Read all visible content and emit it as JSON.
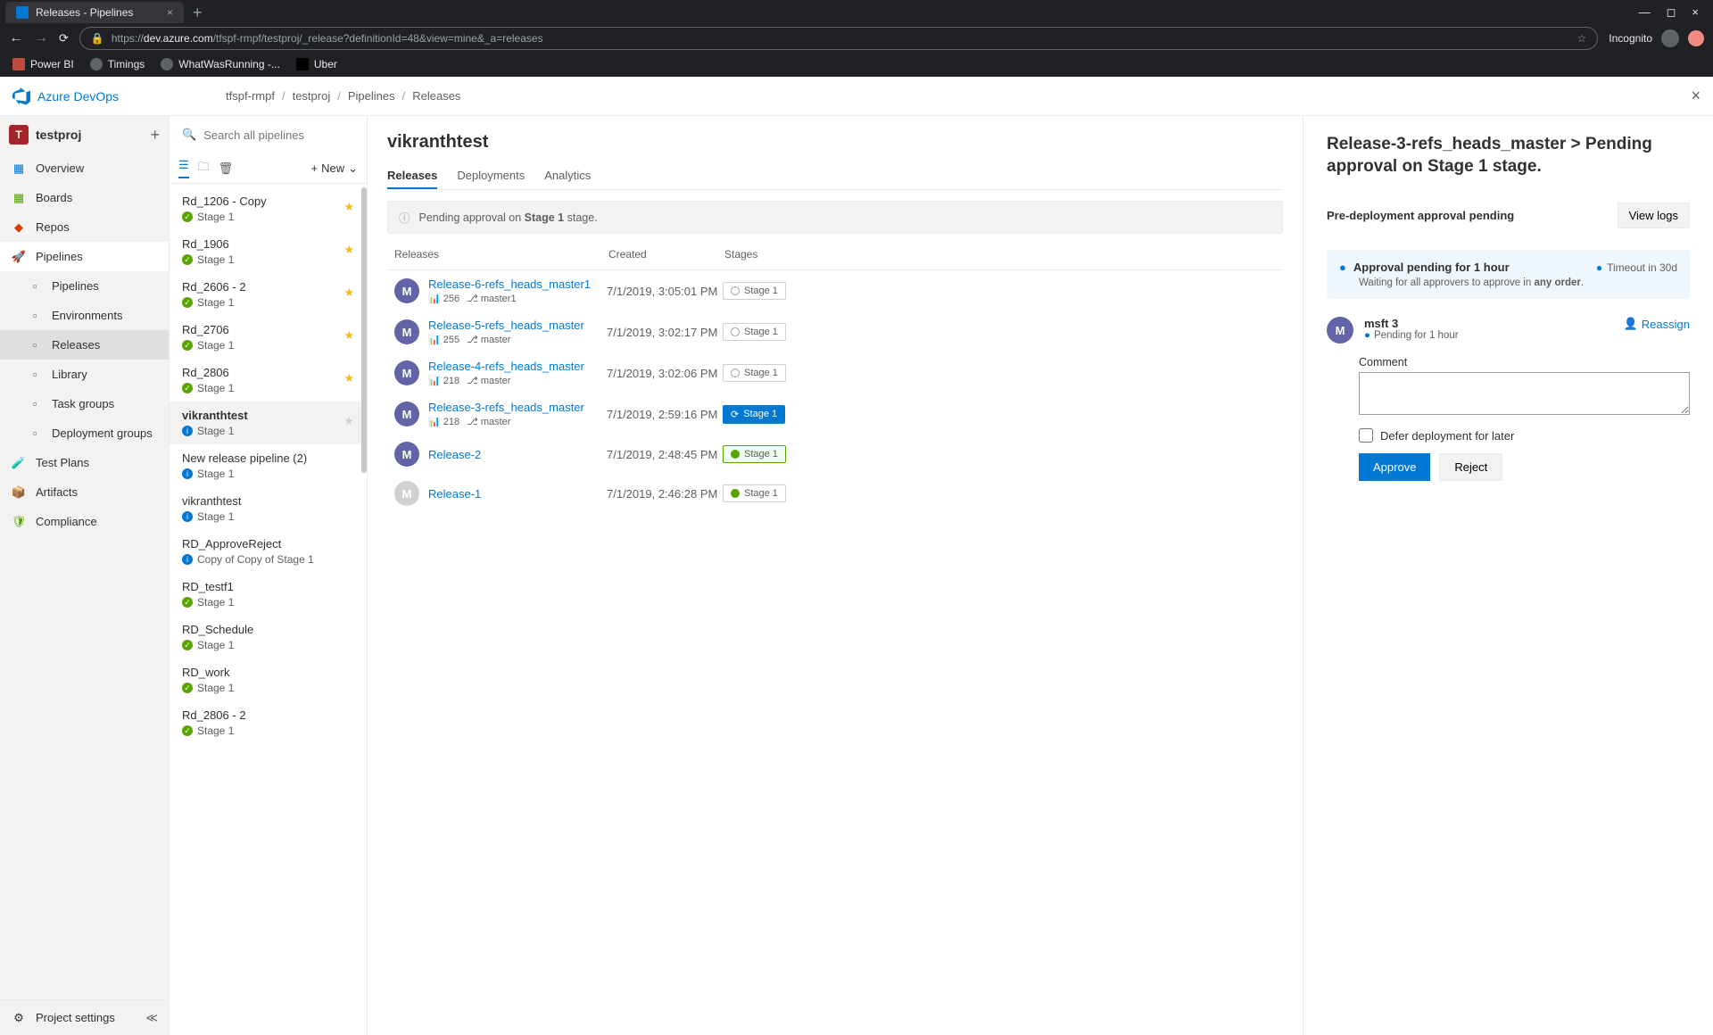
{
  "browser": {
    "tab_title": "Releases - Pipelines",
    "url_prefix": "https://",
    "url_host": "dev.azure.com",
    "url_path": "/tfspf-rmpf/testproj/_release?definitionId=48&view=mine&_a=releases",
    "incognito_label": "Incognito",
    "bookmarks": [
      "Power BI",
      "Timings",
      "WhatWasRunning -...",
      "Uber"
    ]
  },
  "app": {
    "brand": "Azure DevOps",
    "crumbs": [
      "tfspf-rmpf",
      "testproj",
      "Pipelines",
      "Releases"
    ],
    "project": {
      "initial": "T",
      "name": "testproj"
    },
    "nav": [
      {
        "label": "Overview"
      },
      {
        "label": "Boards"
      },
      {
        "label": "Repos"
      },
      {
        "label": "Pipelines",
        "expanded": true,
        "children": [
          {
            "label": "Pipelines"
          },
          {
            "label": "Environments"
          },
          {
            "label": "Releases",
            "active": true
          },
          {
            "label": "Library"
          },
          {
            "label": "Task groups"
          },
          {
            "label": "Deployment groups"
          }
        ]
      },
      {
        "label": "Test Plans"
      },
      {
        "label": "Artifacts"
      },
      {
        "label": "Compliance"
      }
    ],
    "nav_footer": "Project settings"
  },
  "pipelines_col": {
    "search_placeholder": "Search all pipelines",
    "new_label": "New",
    "items": [
      {
        "name": "Rd_1206 - Copy",
        "status_icon": "success",
        "status": "Stage 1",
        "fav": "gold"
      },
      {
        "name": "Rd_1906",
        "status_icon": "success",
        "status": "Stage 1",
        "fav": "gold"
      },
      {
        "name": "Rd_2606 - 2",
        "status_icon": "success",
        "status": "Stage 1",
        "fav": "gold"
      },
      {
        "name": "Rd_2706",
        "status_icon": "success",
        "status": "Stage 1",
        "fav": "gold"
      },
      {
        "name": "Rd_2806",
        "status_icon": "success",
        "status": "Stage 1",
        "fav": "gold"
      },
      {
        "name": "vikranthtest",
        "status_icon": "info",
        "status": "Stage 1",
        "fav": "grey",
        "selected": true
      },
      {
        "name": "New release pipeline (2)",
        "status_icon": "info",
        "status": "Stage 1"
      },
      {
        "name": "vikranthtest",
        "status_icon": "info",
        "status": "Stage 1"
      },
      {
        "name": "RD_ApproveReject",
        "status_icon": "info",
        "status": "Copy of Copy of Stage 1"
      },
      {
        "name": "RD_testf1",
        "status_icon": "success",
        "status": "Stage 1"
      },
      {
        "name": "RD_Schedule",
        "status_icon": "success",
        "status": "Stage 1"
      },
      {
        "name": "RD_work",
        "status_icon": "success",
        "status": "Stage 1"
      },
      {
        "name": "Rd_2806 - 2",
        "status_icon": "success",
        "status": "Stage 1"
      }
    ]
  },
  "main": {
    "title": "vikranthtest",
    "tabs": [
      "Releases",
      "Deployments",
      "Analytics"
    ],
    "banner_prefix": "Pending approval on ",
    "banner_bold": "Stage 1",
    "banner_suffix": " stage.",
    "columns": {
      "releases": "Releases",
      "created": "Created",
      "stages": "Stages"
    },
    "releases": [
      {
        "name": "Release-6-refs_heads_master1",
        "build": "256",
        "branch": "master1",
        "created": "7/1/2019, 3:05:01 PM",
        "stage": "Stage 1",
        "chip": "ring",
        "avatar": "solid"
      },
      {
        "name": "Release-5-refs_heads_master",
        "build": "255",
        "branch": "master",
        "created": "7/1/2019, 3:02:17 PM",
        "stage": "Stage 1",
        "chip": "ring",
        "avatar": "solid"
      },
      {
        "name": "Release-4-refs_heads_master",
        "build": "218",
        "branch": "master",
        "created": "7/1/2019, 3:02:06 PM",
        "stage": "Stage 1",
        "chip": "ring",
        "avatar": "solid"
      },
      {
        "name": "Release-3-refs_heads_master",
        "build": "218",
        "branch": "master",
        "created": "7/1/2019, 2:59:16 PM",
        "stage": "Stage 1",
        "chip": "blue",
        "avatar": "solid"
      },
      {
        "name": "Release-2",
        "build": "",
        "branch": "",
        "created": "7/1/2019, 2:48:45 PM",
        "stage": "Stage 1",
        "chip": "green",
        "avatar": "solid"
      },
      {
        "name": "Release-1",
        "build": "",
        "branch": "",
        "created": "7/1/2019, 2:46:28 PM",
        "stage": "Stage 1",
        "chip": "grey-done",
        "avatar": "dim"
      }
    ]
  },
  "panel": {
    "title": "Release-3-refs_heads_master > Pending approval on Stage 1 stage.",
    "subtitle": "Pre-deployment approval pending",
    "view_logs": "View logs",
    "approval_title": "Approval pending for 1 hour",
    "approval_sub_prefix": "Waiting for all approvers to approve in ",
    "approval_sub_bold": "any order",
    "timeout": "Timeout in 30d",
    "approver": {
      "initial": "M",
      "name": "msft 3",
      "pending": "Pending for 1 hour"
    },
    "reassign": "Reassign",
    "comment_label": "Comment",
    "defer_label": "Defer deployment for later",
    "approve_label": "Approve",
    "reject_label": "Reject"
  }
}
